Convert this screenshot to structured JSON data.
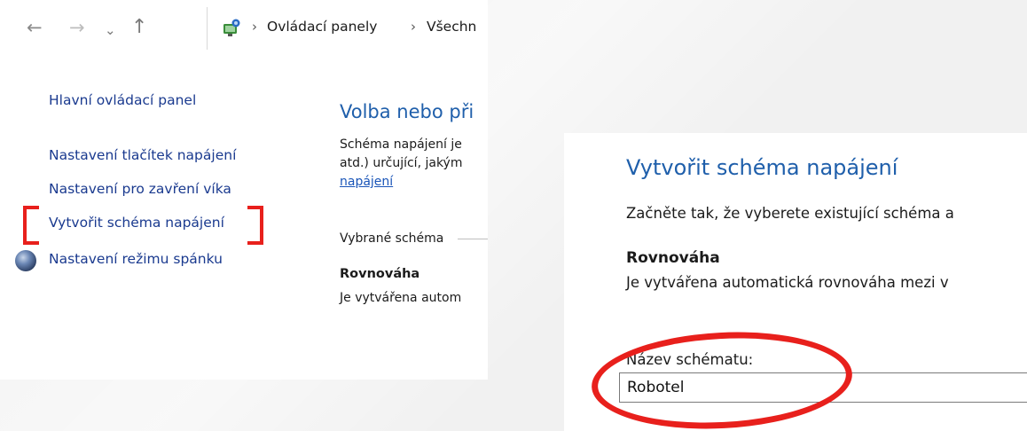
{
  "nav": {
    "back": "←",
    "forward": "→",
    "recent": "⌄",
    "up": "↑",
    "breadcrumb": [
      "Ovládací panely",
      "Všechn"
    ],
    "chevron": "›"
  },
  "sidebar": {
    "items": [
      {
        "label": "Hlavní ovládací panel"
      },
      {
        "label": "Nastavení tlačítek napájení"
      },
      {
        "label": "Nastavení pro zavření víka"
      },
      {
        "label": "Vytvořit schéma napájení"
      },
      {
        "label": "Nastavení režimu spánku"
      }
    ]
  },
  "main": {
    "title": "Volba nebo při",
    "desc_line1": "Schéma napájení je",
    "desc_line2": "atd.) určující, jakým",
    "desc_link": "napájení",
    "selected_label": "Vybrané schéma",
    "scheme_name": "Rovnováha",
    "scheme_desc": "Je vytvářena autom"
  },
  "create_plan": {
    "title": "Vytvořit schéma napájení",
    "intro": "Začněte tak, že vyberete existující schéma a",
    "scheme_name": "Rovnováha",
    "scheme_desc": "Je vytvářena automatická rovnováha mezi v",
    "name_label": "Název schématu:",
    "name_value": "Robotel"
  },
  "colors": {
    "highlight": "#e8201c",
    "title_blue": "#1f5fab",
    "link_blue": "#1a3a8f"
  }
}
